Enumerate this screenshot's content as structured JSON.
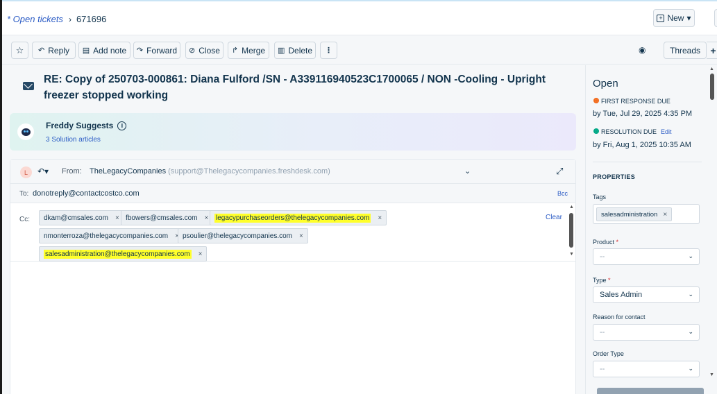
{
  "breadcrumb": {
    "link": "* Open tickets",
    "separator": "›",
    "ticket_id": "671696"
  },
  "header": {
    "new_button": "New",
    "new_chevron": "▾"
  },
  "toolbar": {
    "star_icon": "☆",
    "reply": "Reply",
    "note": "Add note",
    "forward": "Forward",
    "close": "Close",
    "merge": "Merge",
    "delete": "Delete",
    "more": "⋮",
    "threads": "Threads",
    "plus": "+",
    "eye": "◉"
  },
  "ticket": {
    "subject": "RE: Copy of 250703-000861: Diana Fulford /SN - A339116940523C1700065 / NON -Cooling - Upright freezer stopped working"
  },
  "freddy": {
    "title": "Freddy Suggests",
    "info": "i",
    "link": "3 Solution articles"
  },
  "compose": {
    "avatar_letter": "L",
    "reply_icon": "↶▾",
    "from_label": "From:",
    "from_name": "TheLegacyCompanies",
    "from_email": "(support@Thelegacycompanies.freshdesk.com)",
    "from_chevron": "⌄",
    "expand_icon": "⤢",
    "to_label": "To:",
    "to_value": "donotreply@contactcostco.com",
    "bcc": "Bcc",
    "cc_label": "Cc:",
    "clear": "Clear",
    "cc": [
      {
        "email": "dkam@cmsales.com"
      },
      {
        "email": "fbowers@cmsales.com"
      },
      {
        "email": "legacypurchaseorders@thelegacycompanies.com",
        "highlight": true
      },
      {
        "email": "nmonterroza@thelegacycompanies.com"
      },
      {
        "email": "psoulier@thelegacycompanies.com"
      },
      {
        "email": "salesadministration@thelegacycompanies.com",
        "highlight": true
      }
    ],
    "chip_remove": "×"
  },
  "panel": {
    "status": "Open",
    "first_response_label": "FIRST RESPONSE DUE",
    "first_response_date": "by Tue, Jul 29, 2025 4:35 PM",
    "first_response_color": "#f26b1d",
    "resolution_label": "RESOLUTION DUE",
    "resolution_edit": "Edit",
    "resolution_date": "by Fri, Aug 1, 2025 10:35 AM",
    "resolution_color": "#00a886",
    "properties_title": "PROPERTIES",
    "tags_label": "Tags",
    "tag": "salesadministration",
    "product_label": "Product",
    "product_value": "--",
    "type_label": "Type",
    "type_value": "Sales Admin",
    "reason_label": "Reason for contact",
    "reason_value": "--",
    "order_type_label": "Order Type",
    "order_type_value": "--",
    "required_mark": "*",
    "chevron": "⌄"
  }
}
